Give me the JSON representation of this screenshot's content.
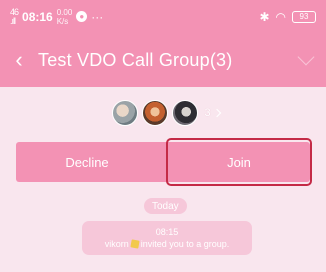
{
  "status_bar": {
    "signal": "46\n.ıll",
    "time": "08:16",
    "network_speed": "0.00\nK/s",
    "app_icon": "chat-app-icon",
    "more": "···",
    "bluetooth_icon": "bluetooth-icon",
    "wifi_icon": "wifi-icon",
    "battery": "93"
  },
  "header": {
    "back_icon": "‹",
    "title": "Test VDO Call Group(3)"
  },
  "members": {
    "count": "3"
  },
  "actions": {
    "decline_label": "Decline",
    "join_label": "Join"
  },
  "chat": {
    "date_label": "Today",
    "message": {
      "time": "08:15",
      "sender": "vikorn",
      "text": "invited you to a group."
    }
  },
  "colors": {
    "accent": "#f392b4",
    "background": "#f9e6ee",
    "highlight_border": "#c42a46"
  }
}
